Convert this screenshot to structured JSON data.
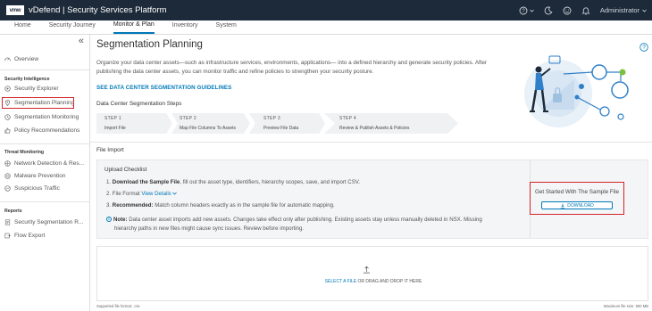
{
  "header": {
    "logo": "vmw",
    "title": "vDefend | Security Services Platform",
    "user": "Administrator"
  },
  "nav": {
    "tabs": [
      {
        "label": "Home"
      },
      {
        "label": "Security Journey"
      },
      {
        "label": "Monitor & Plan"
      },
      {
        "label": "Inventory"
      },
      {
        "label": "System"
      }
    ],
    "active_tab": "Monitor & Plan"
  },
  "sidebar": {
    "collapse_icon": "«",
    "overview": "Overview",
    "section_intel": "Security Intelligence",
    "security_explorer": "Security Explorer",
    "segmentation_planning": "Segmentation Planning",
    "segmentation_monitoring": "Segmentation Monitoring",
    "policy_recommendations": "Policy Recommendations",
    "section_threat": "Threat Monitoring",
    "network_detection": "Network Detection & Res...",
    "malware_prevention": "Malware Prevention",
    "suspicious_traffic": "Suspicious Traffic",
    "section_reports": "Reports",
    "security_segmentation_r": "Security Segmentation R...",
    "flow_export": "Flow Export"
  },
  "main": {
    "title": "Segmentation Planning",
    "intro_line1": "Organize your data center assets—such as infrastructure services, environments, applications— into a defined hierarchy and generate security policies. After",
    "intro_line2": "publishing the data center assets, you can monitor traffic and refine policies to strengthen your security posture.",
    "guide_link": "SEE DATA CENTER SEGMENTATION GUIDELINES",
    "steps_title": "Data Center Segmentation Steps",
    "steps": [
      {
        "num": "STEP 1",
        "label": "Import File"
      },
      {
        "num": "STEP 2",
        "label": "Map File Columns To Assets"
      },
      {
        "num": "STEP 3",
        "label": "Preview File Data"
      },
      {
        "num": "STEP 4",
        "label": "Review & Publish Assets & Policies"
      }
    ],
    "file_import": "File Import",
    "checklist": {
      "title": "Upload Checklist",
      "item1_num": "1.",
      "item1_bold": "Download the Sample File",
      "item1_rest": ", fill out the asset type, identifiers, hierarchy scopes, save, and import CSV.",
      "item2_num": "2.",
      "item2_text": "File Format",
      "item2_link": "View Details",
      "item3_num": "3.",
      "item3_bold": "Recommended:",
      "item3_rest": " Match column headers exactly as in the sample file for automatic mapping.",
      "note_bold": "Note:",
      "note_line1": " Data center asset imports add new assets. Changes take effect only after publishing. Existing assets stay unless manually deleted in NSX. Missing",
      "note_line2": "hierarchy paths in new files might cause sync issues. Review before importing."
    },
    "sample": {
      "title": "Get Started With The Sample File",
      "download": "DOWNLOAD"
    },
    "dropzone": {
      "select": "SELECT A FILE",
      "rest": " OR DRAG AND DROP IT HERE"
    },
    "footer_left": "Supported file format: .csv",
    "footer_right": "Maximum file size: 500 MB"
  },
  "colors": {
    "header_bg": "#1d2a39",
    "accent": "#0079b8",
    "highlight": "#d3242b"
  }
}
